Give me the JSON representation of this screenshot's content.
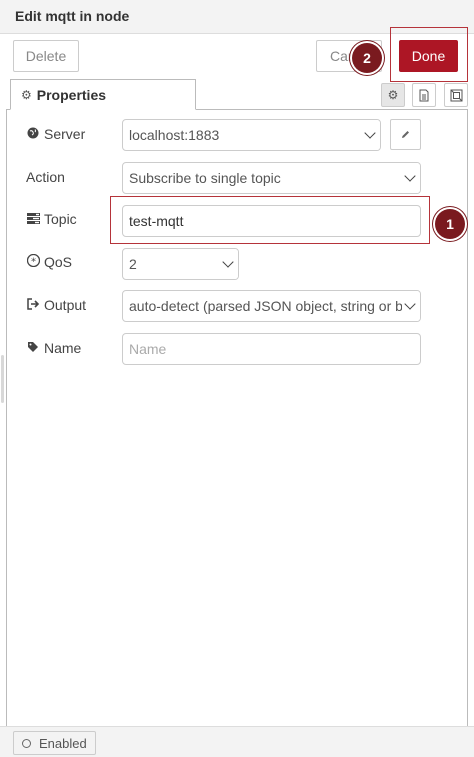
{
  "window": {
    "title": "Edit mqtt in node"
  },
  "toolbar": {
    "delete_label": "Delete",
    "cancel_label": "Cancel",
    "done_label": "Done"
  },
  "tabs": [
    {
      "label": "Properties",
      "icon": "gear-icon"
    }
  ],
  "tab_tools": [
    {
      "icon": "gear-icon"
    },
    {
      "icon": "document-icon"
    },
    {
      "icon": "frame-icon"
    }
  ],
  "form": {
    "server": {
      "label": "Server",
      "icon": "globe-icon",
      "value": "localhost:1883"
    },
    "action": {
      "label": "Action",
      "value": "Subscribe to single topic"
    },
    "topic": {
      "label": "Topic",
      "icon": "tasks-icon",
      "value": "test-mqtt"
    },
    "qos": {
      "label": "QoS",
      "icon": "asterisk-icon",
      "value": "2"
    },
    "output": {
      "label": "Output",
      "icon": "sign-out-icon",
      "value": "auto-detect (parsed JSON object, string or buffer)"
    },
    "name": {
      "label": "Name",
      "icon": "tag-icon",
      "placeholder": "Name",
      "value": ""
    }
  },
  "annotations": [
    {
      "number": "1",
      "target": "topic"
    },
    {
      "number": "2",
      "target": "done-button"
    }
  ],
  "footer": {
    "enabled_label": "Enabled"
  },
  "colors": {
    "accent": "#ad1625",
    "annotation": "#7a1a1f"
  }
}
